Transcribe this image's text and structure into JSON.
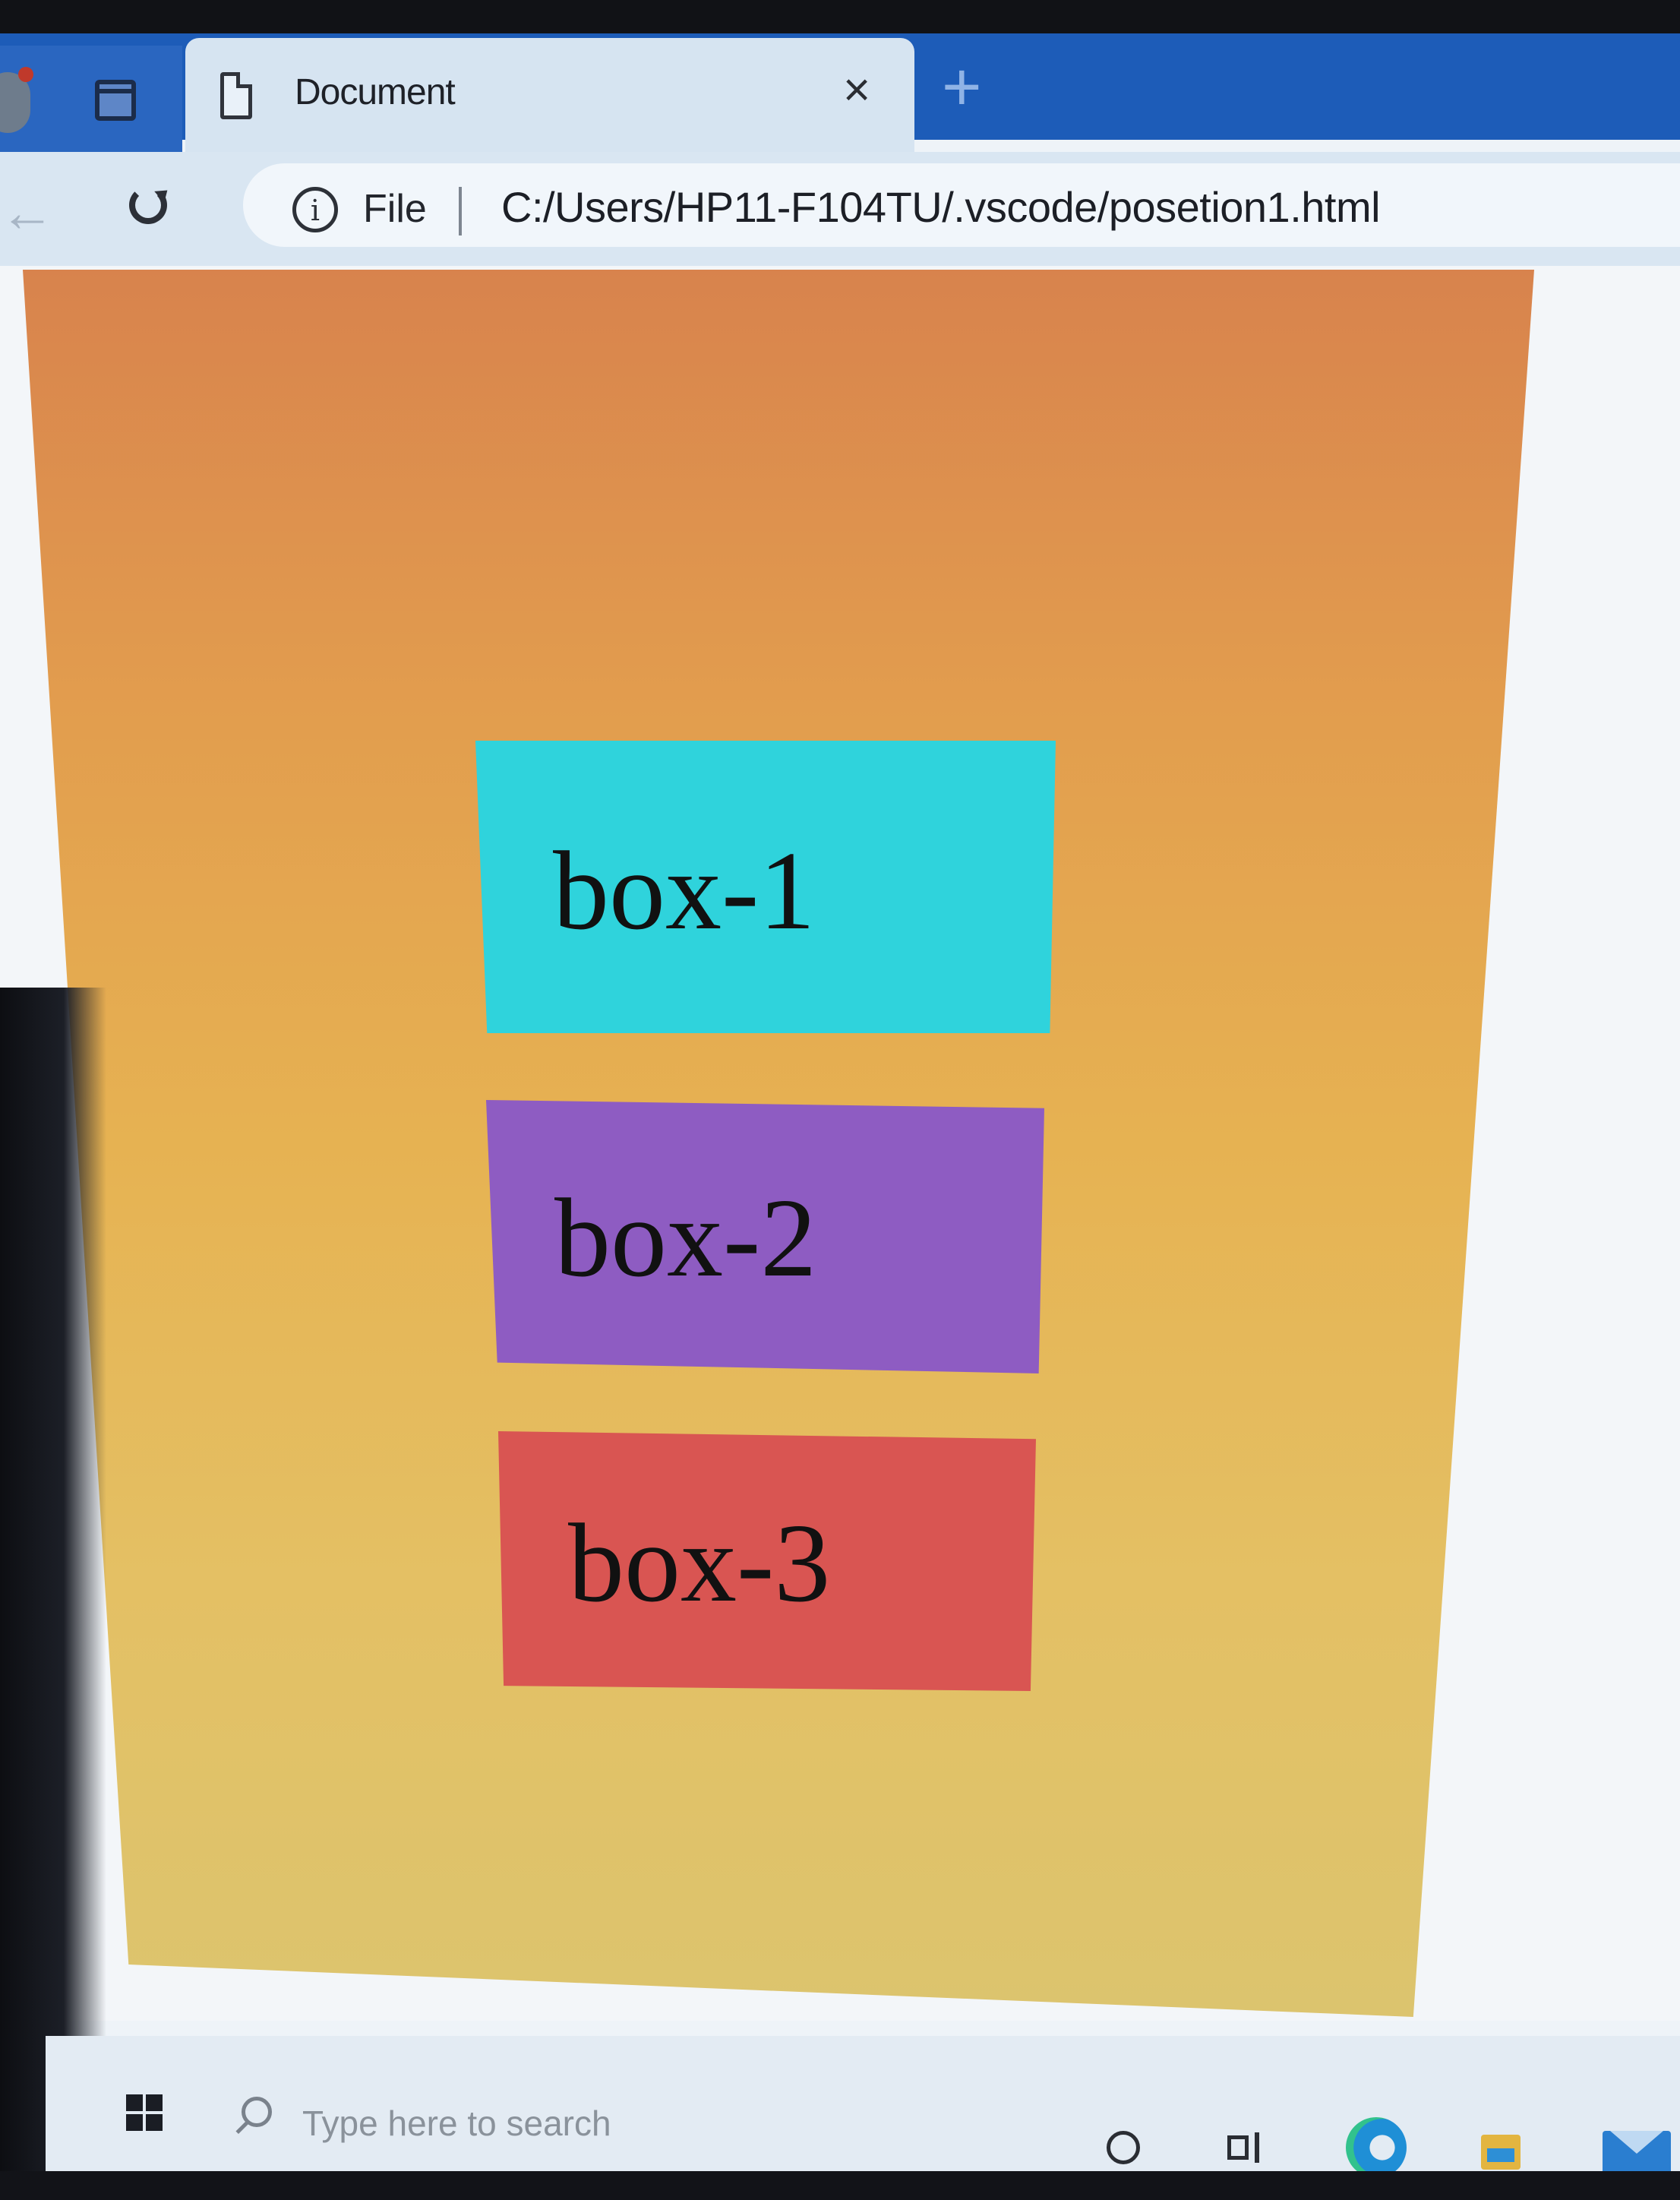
{
  "browser": {
    "tab": {
      "title": "Document",
      "close_glyph": "×"
    },
    "new_tab_glyph": "+",
    "address_bar": {
      "scheme_label": "File",
      "url": "C:/Users/HP11-F104TU/.vscode/posetion1.html"
    }
  },
  "page": {
    "boxes": [
      {
        "label": "box-1",
        "color": "#2fd3dc"
      },
      {
        "label": "box-2",
        "color": "#8e5cc2"
      },
      {
        "label": "box-3",
        "color": "#d95552"
      }
    ],
    "container_color": "#e6b252"
  },
  "taskbar": {
    "search_placeholder": "Type here to search"
  },
  "icons": {
    "profile": "profile-icon",
    "tab_actions": "tabs-icon",
    "document": "document-icon",
    "back": "back-arrow-icon",
    "reload": "reload-icon",
    "info": "info-icon",
    "windows": "windows-start-icon",
    "search": "search-icon",
    "cortana": "cortana-icon",
    "task_view": "task-view-icon",
    "edge": "edge-icon",
    "file_explorer": "file-explorer-icon",
    "mail": "mail-icon"
  }
}
